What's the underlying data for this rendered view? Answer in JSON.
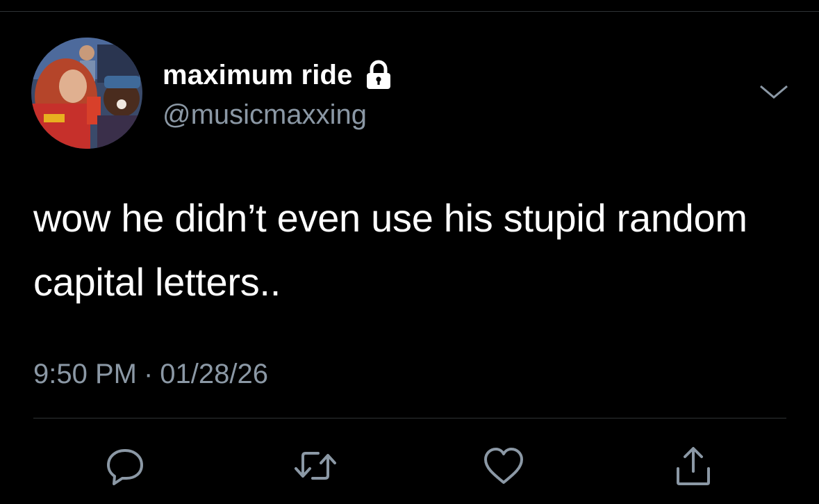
{
  "user": {
    "display_name": "maximum ride",
    "handle": "@musicmaxxing",
    "protected_icon": "lock-icon",
    "avatar_alt": "profile photo"
  },
  "tweet": {
    "text": "wow he didn’t even use his stupid random capital letters..",
    "time": "9:50 PM",
    "separator": "·",
    "date": "01/28/26"
  },
  "actions": {
    "reply_icon": "reply-icon",
    "retweet_icon": "retweet-icon",
    "like_icon": "heart-icon",
    "share_icon": "share-icon"
  },
  "colors": {
    "background": "#000000",
    "text_primary": "#ffffff",
    "text_secondary": "#8b98a5",
    "divider": "#2f3336"
  }
}
